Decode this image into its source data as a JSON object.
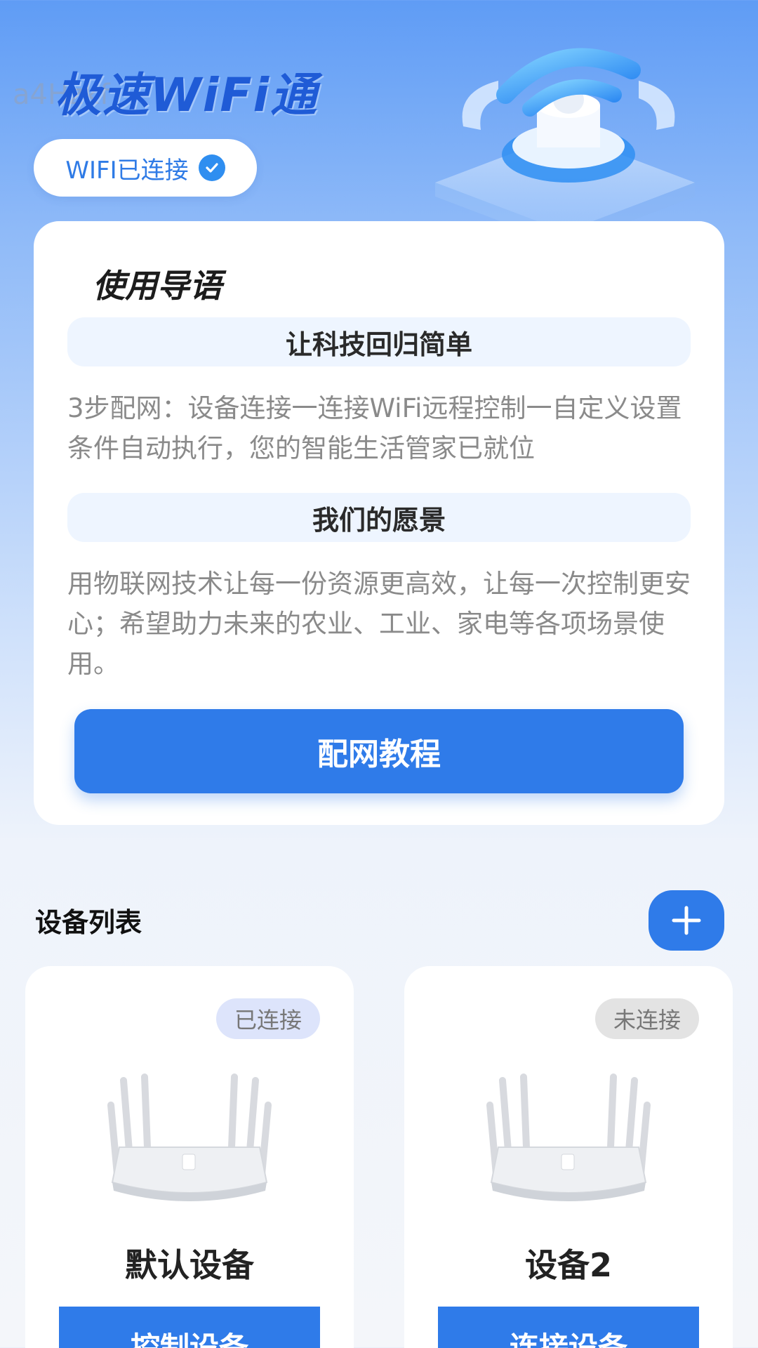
{
  "header": {
    "watermark": "a4Hzkf",
    "app_title": "极速WiFi通",
    "status_text": "WIFI已连接"
  },
  "guide": {
    "title": "使用导语",
    "section1_heading": "让科技回归简单",
    "section1_body": "3步配网：设备连接一连接WiFi远程控制一自定义设置条件自动执行，您的智能生活管家已就位",
    "section2_heading": "我们的愿景",
    "section2_body": "用物联网技术让每一份资源更高效，让每一次控制更安心；希望助力未来的农业、工业、家电等各项场景使用。",
    "button_label": "配网教程"
  },
  "devices": {
    "title": "设备列表",
    "items": [
      {
        "status": "已连接",
        "name": "默认设备",
        "action": "控制设备"
      },
      {
        "status": "未连接",
        "name": "设备2",
        "action": "连接设备"
      }
    ]
  },
  "colors": {
    "primary": "#2f7be9",
    "brand_title": "#1f5bd6"
  }
}
